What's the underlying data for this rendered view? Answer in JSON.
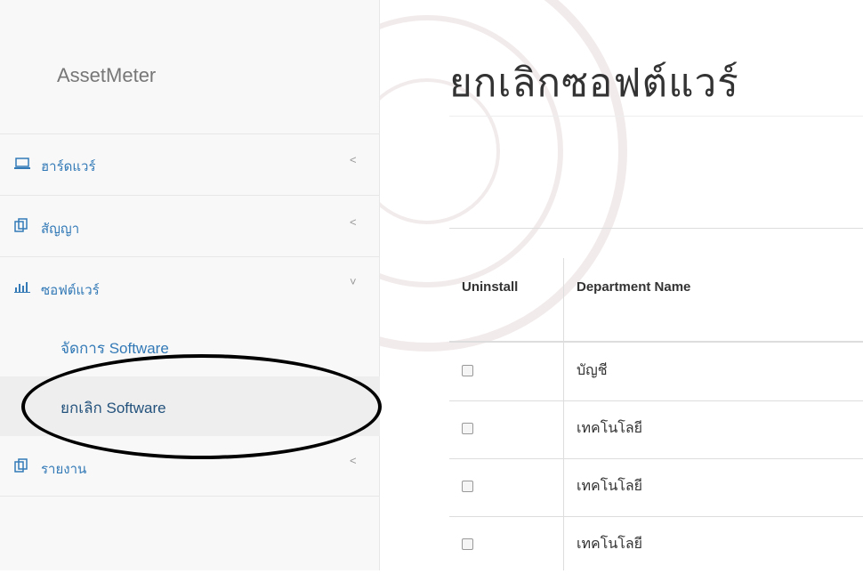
{
  "app": {
    "brand": "AssetMeter"
  },
  "page": {
    "title": "ยกเลิกซอฟต์แวร์"
  },
  "sidebar": {
    "items": [
      {
        "label": "ฮาร์ดแวร์",
        "icon": "laptop-icon",
        "chevron": "<"
      },
      {
        "label": "สัญญา",
        "icon": "copy-icon",
        "chevron": "<"
      },
      {
        "label": "ซอฟต์แวร์",
        "icon": "bar-chart-icon",
        "chevron": "˅"
      },
      {
        "label": "รายงาน",
        "icon": "copy-icon",
        "chevron": "<"
      }
    ],
    "sub_items": [
      {
        "label": "จัดการ Software"
      },
      {
        "label": "ยกเลิก Software"
      }
    ]
  },
  "table": {
    "headers": [
      "Uninstall",
      "Department Name"
    ],
    "rows": [
      {
        "checked": false,
        "department": "บัญชี"
      },
      {
        "checked": false,
        "department": "เทคโนโลยี"
      },
      {
        "checked": false,
        "department": "เทคโนโลยี"
      },
      {
        "checked": false,
        "department": "เทคโนโลยี"
      }
    ]
  },
  "colors": {
    "link": "#337ab7",
    "sidebar_bg": "#f8f8f8",
    "active_bg": "#eeeeee"
  }
}
